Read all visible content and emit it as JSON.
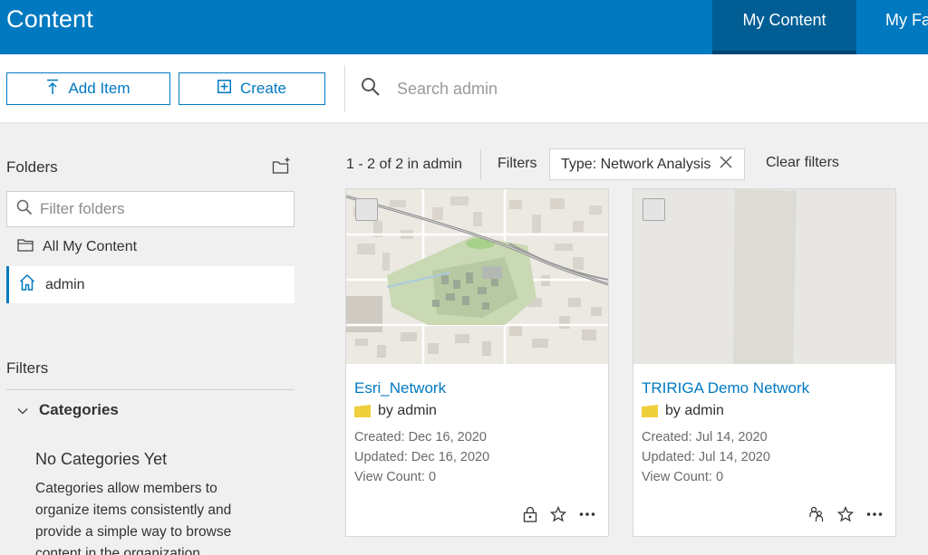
{
  "header": {
    "title": "Content",
    "tabs": [
      {
        "label": "My Content"
      },
      {
        "label": "My Fa"
      }
    ]
  },
  "toolbar": {
    "add_item_label": "Add Item",
    "create_label": "Create",
    "search_placeholder": "Search admin"
  },
  "sidebar": {
    "folders_title": "Folders",
    "filter_placeholder": "Filter folders",
    "items": [
      {
        "label": "All My Content"
      },
      {
        "label": "admin"
      }
    ],
    "filters_title": "Filters",
    "categories_label": "Categories",
    "no_categories_title": "No Categories Yet",
    "no_categories_desc": "Categories allow members to organize items consistently and provide a simple way to browse content in the organization."
  },
  "results": {
    "count": "1 - 2 of 2 in admin",
    "filters_label": "Filters",
    "active_filter": "Type: Network Analysis",
    "clear_filters": "Clear filters"
  },
  "cards": [
    {
      "title": "Esri_Network",
      "owner": "by admin",
      "created": "Created: Dec 16, 2020",
      "updated": "Updated: Dec 16, 2020",
      "views": "View Count: 0",
      "status_icon": "lock-icon"
    },
    {
      "title": "TRIRIGA Demo Network",
      "owner": "by admin",
      "created": "Created: Jul 14, 2020",
      "updated": "Updated: Jul 14, 2020",
      "views": "View Count: 0",
      "status_icon": "shared-users-icon"
    }
  ],
  "colors": {
    "brand": "#0079c1",
    "header_active": "#005e95",
    "folder_swatch": "#f0cf3d"
  }
}
